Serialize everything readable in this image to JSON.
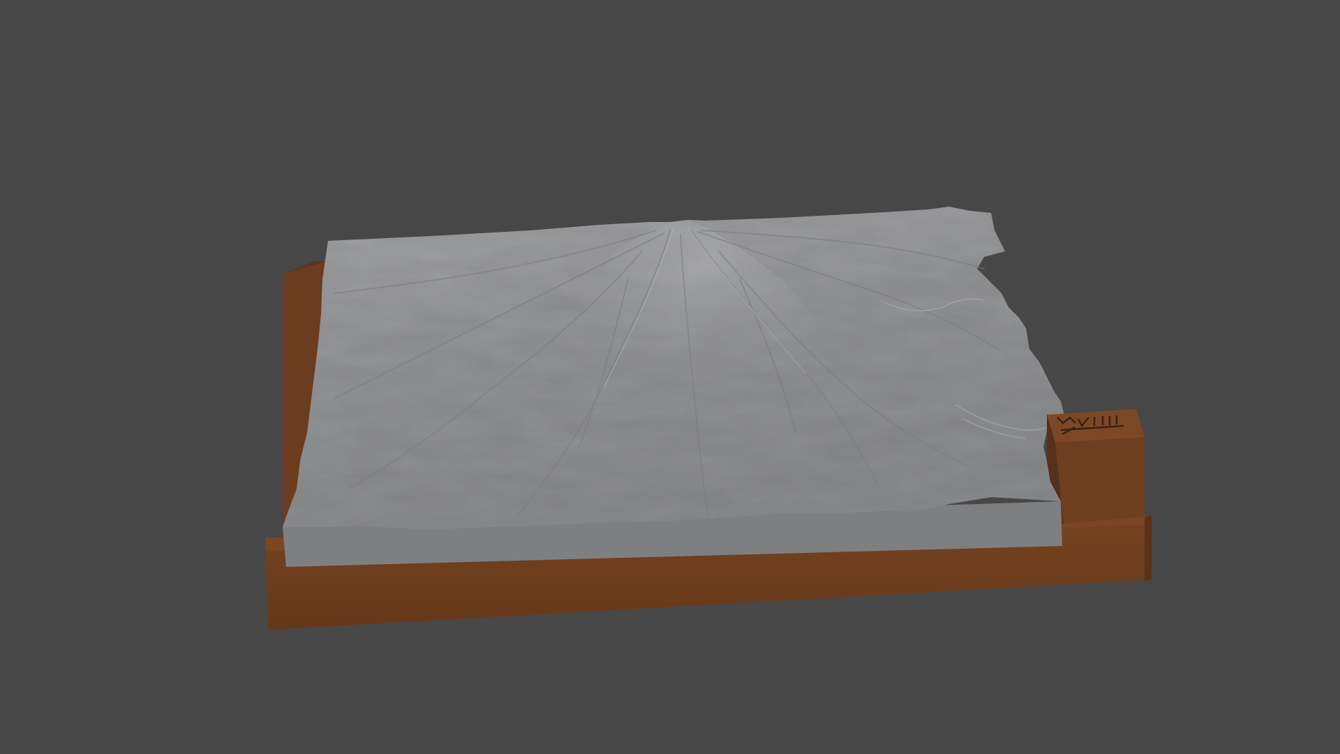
{
  "viewport": {
    "background_color": "#474747"
  },
  "model": {
    "terrain_color": "#8e8f91",
    "terrain_side_color": "#7c7d7f",
    "base_color": "#6b3d1e",
    "base_dark_color": "#5a3217",
    "base_light_color": "#7a4624",
    "label_block_color": "#6e3f1f",
    "label_engraving_color": "#3a2010"
  }
}
